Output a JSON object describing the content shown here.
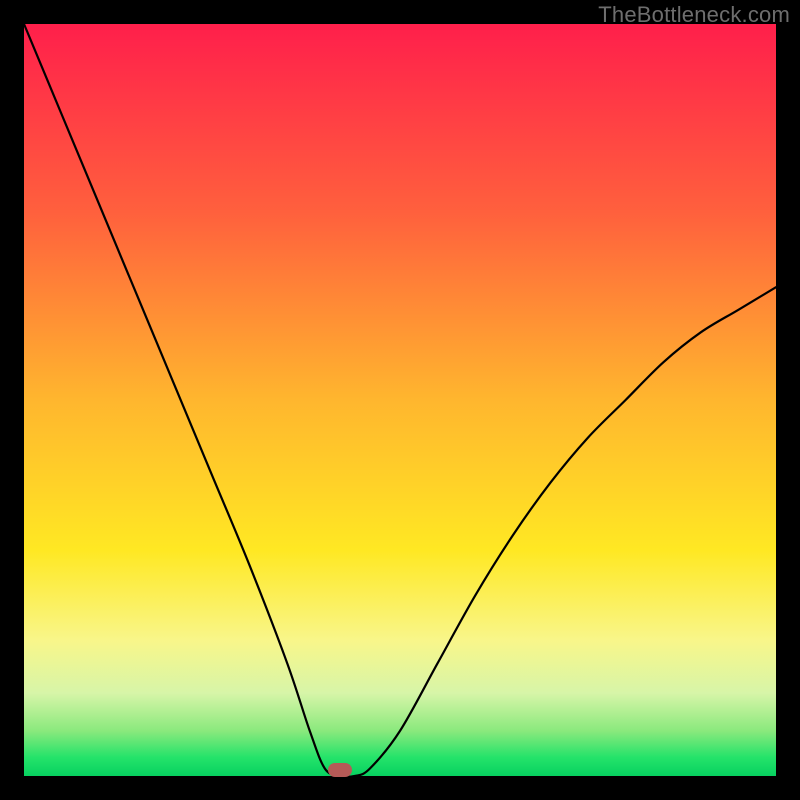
{
  "watermark": "TheBottleneck.com",
  "chart_data": {
    "type": "line",
    "title": "",
    "xlabel": "",
    "ylabel": "",
    "xlim": [
      0,
      100
    ],
    "ylim": [
      0,
      100
    ],
    "grid": false,
    "background": "gradient",
    "gradient_colors": [
      "#ff1f4b",
      "#ff603d",
      "#ffb62e",
      "#ffe823",
      "#f8f68a",
      "#d7f5a8",
      "#8ae97d",
      "#25e36a",
      "#07d160"
    ],
    "series": [
      {
        "name": "bottleneck-curve",
        "x": [
          0,
          5,
          10,
          15,
          20,
          25,
          30,
          35,
          38,
          40,
          42,
          44,
          46,
          50,
          55,
          60,
          65,
          70,
          75,
          80,
          85,
          90,
          95,
          100
        ],
        "y": [
          100,
          88,
          76,
          64,
          52,
          40,
          28,
          15,
          6,
          1,
          0,
          0,
          1,
          6,
          15,
          24,
          32,
          39,
          45,
          50,
          55,
          59,
          62,
          65
        ]
      }
    ],
    "annotations": [
      {
        "name": "minimum-marker",
        "x": 42,
        "y": 0,
        "shape": "pill",
        "color": "#b55a57"
      }
    ]
  }
}
